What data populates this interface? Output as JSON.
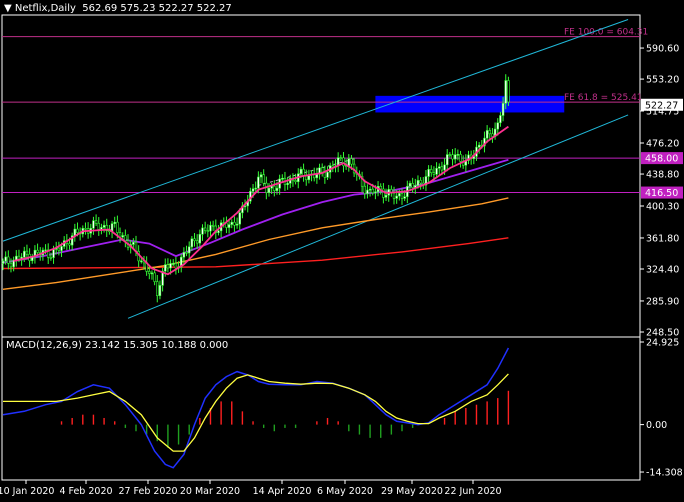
{
  "header": {
    "symbol": "Netflix,Daily",
    "ohlc": "562.69 575.23 522.27 522.27"
  },
  "macd_header": {
    "label": "MACD(12,26,9) 23.142 15.305 10.188 0.000"
  },
  "colors": {
    "background": "#000000",
    "frame": "#ffffff",
    "bull_candle": "#33ff33",
    "bear_candle": "#33ff33",
    "ma_fast": "#ff2f8f",
    "ma_mid": "#a020f0",
    "ma_slow": "#ff9a28",
    "ma_200": "#ff2020",
    "channel": "#20b8d8",
    "fib_line": "#c0308a",
    "level_line": "#c020c0",
    "zone": "#0000ff",
    "macd_line": "#2030ff",
    "signal_line": "#ffff40",
    "hist_pos": "#ff2020",
    "hist_neg": "#20a020",
    "price_tag_bg": "#ffffff",
    "level_tag_bg": "#c020c0"
  },
  "chart_data": [
    {
      "type": "candlestick",
      "symbol": "Netflix",
      "timeframe": "Daily",
      "ylim": [
        248.5,
        628
      ],
      "y_ticks": [
        "590.60",
        "553.20",
        "514.75",
        "476.20",
        "438.80",
        "400.30",
        "361.80",
        "324.40",
        "285.90",
        "248.50"
      ],
      "x_ticks": [
        "10 Jan 2020",
        "4 Feb 2020",
        "27 Feb 2020",
        "20 Mar 2020",
        "14 Apr 2020",
        "6 May 2020",
        "29 May 2020",
        "22 Jun 2020"
      ],
      "last_price": "522.27",
      "close_anchors": [
        [
          0,
          331
        ],
        [
          10,
          342
        ],
        [
          20,
          345
        ],
        [
          26,
          364
        ],
        [
          33,
          376
        ],
        [
          42,
          374
        ],
        [
          50,
          345
        ],
        [
          55,
          320
        ],
        [
          58,
          298
        ],
        [
          61,
          330
        ],
        [
          64,
          325
        ],
        [
          70,
          350
        ],
        [
          74,
          368
        ],
        [
          80,
          375
        ],
        [
          86,
          377
        ],
        [
          90,
          394
        ],
        [
          96,
          436
        ],
        [
          99,
          420
        ],
        [
          105,
          428
        ],
        [
          112,
          437
        ],
        [
          120,
          439
        ],
        [
          126,
          453
        ],
        [
          130,
          455
        ],
        [
          134,
          430
        ],
        [
          138,
          416
        ],
        [
          142,
          420
        ],
        [
          148,
          410
        ],
        [
          152,
          420
        ],
        [
          156,
          428
        ],
        [
          160,
          437
        ],
        [
          166,
          452
        ],
        [
          170,
          464
        ],
        [
          174,
          450
        ],
        [
          178,
          470
        ],
        [
          183,
          487
        ],
        [
          186,
          498
        ],
        [
          188,
          525
        ],
        [
          189,
          545
        ],
        [
          190,
          522.27
        ]
      ],
      "ma_fast": [
        [
          4,
          334
        ],
        [
          12,
          340
        ],
        [
          20,
          350
        ],
        [
          30,
          370
        ],
        [
          40,
          372
        ],
        [
          48,
          352
        ],
        [
          56,
          325
        ],
        [
          62,
          318
        ],
        [
          68,
          330
        ],
        [
          75,
          352
        ],
        [
          80,
          370
        ],
        [
          88,
          392
        ],
        [
          96,
          420
        ],
        [
          104,
          428
        ],
        [
          112,
          436
        ],
        [
          120,
          440
        ],
        [
          128,
          452
        ],
        [
          132,
          444
        ],
        [
          136,
          430
        ],
        [
          144,
          416
        ],
        [
          152,
          418
        ],
        [
          160,
          428
        ],
        [
          168,
          446
        ],
        [
          176,
          458
        ],
        [
          182,
          478
        ],
        [
          190,
          496
        ]
      ],
      "ma_mid": [
        [
          0,
          332
        ],
        [
          15,
          340
        ],
        [
          30,
          350
        ],
        [
          45,
          360
        ],
        [
          55,
          355
        ],
        [
          65,
          340
        ],
        [
          78,
          356
        ],
        [
          90,
          372
        ],
        [
          105,
          390
        ],
        [
          120,
          405
        ],
        [
          132,
          414
        ],
        [
          145,
          418
        ],
        [
          160,
          428
        ],
        [
          175,
          442
        ],
        [
          190,
          456
        ]
      ],
      "ma_slow": [
        [
          0,
          300
        ],
        [
          20,
          308
        ],
        [
          40,
          318
        ],
        [
          60,
          328
        ],
        [
          80,
          342
        ],
        [
          100,
          360
        ],
        [
          120,
          374
        ],
        [
          140,
          384
        ],
        [
          160,
          393
        ],
        [
          180,
          403
        ],
        [
          190,
          410
        ]
      ],
      "ma_200": [
        [
          0,
          325
        ],
        [
          40,
          326
        ],
        [
          80,
          327
        ],
        [
          120,
          335
        ],
        [
          150,
          345
        ],
        [
          175,
          355
        ],
        [
          190,
          362
        ]
      ],
      "channel_lines": [
        [
          [
            0,
            358
          ],
          [
            235,
            625
          ]
        ],
        [
          [
            47,
            265
          ],
          [
            235,
            510
          ]
        ]
      ],
      "dashed_line": [
        [
          96,
          425
        ],
        [
          133,
          458
        ]
      ],
      "fib_lines": [
        {
          "label": "FE 100.0 = 604.31",
          "value": 604.31
        },
        {
          "label": "FE 61.8 = 525.41",
          "value": 525.41
        }
      ],
      "level_lines": [
        {
          "label": "458.00",
          "value": 458.0
        },
        {
          "label": "416.50",
          "value": 416.5
        }
      ],
      "zone": {
        "from_bar": 140,
        "to_bar": 211,
        "low": 513,
        "high": 533
      }
    },
    {
      "type": "histogram+line",
      "title": "MACD(12,26,9) 23.142 15.305 10.188 0.000",
      "ylim": [
        -14.3,
        24.925
      ],
      "y_ticks": [
        "24.925",
        "0.00",
        "-14.308"
      ],
      "macd_line": [
        [
          0,
          3
        ],
        [
          8,
          4
        ],
        [
          16,
          6
        ],
        [
          22,
          7
        ],
        [
          28,
          10
        ],
        [
          34,
          12
        ],
        [
          40,
          11
        ],
        [
          46,
          6
        ],
        [
          52,
          0
        ],
        [
          57,
          -8
        ],
        [
          61,
          -12
        ],
        [
          64,
          -13
        ],
        [
          68,
          -9
        ],
        [
          72,
          0
        ],
        [
          76,
          8
        ],
        [
          80,
          12
        ],
        [
          84,
          14.5
        ],
        [
          88,
          16
        ],
        [
          92,
          15
        ],
        [
          96,
          13
        ],
        [
          100,
          12.2
        ],
        [
          106,
          12
        ],
        [
          112,
          12
        ],
        [
          118,
          13
        ],
        [
          124,
          12.5
        ],
        [
          130,
          11
        ],
        [
          136,
          9
        ],
        [
          140,
          6
        ],
        [
          144,
          3
        ],
        [
          148,
          1
        ],
        [
          152,
          0.5
        ],
        [
          156,
          0
        ],
        [
          160,
          0.5
        ],
        [
          164,
          3
        ],
        [
          170,
          6
        ],
        [
          176,
          9
        ],
        [
          182,
          12
        ],
        [
          186,
          17
        ],
        [
          190,
          23.1
        ]
      ],
      "signal_line": [
        [
          0,
          7
        ],
        [
          10,
          7
        ],
        [
          20,
          7
        ],
        [
          28,
          8
        ],
        [
          34,
          9
        ],
        [
          40,
          10
        ],
        [
          46,
          7
        ],
        [
          52,
          3
        ],
        [
          58,
          -4
        ],
        [
          64,
          -8
        ],
        [
          68,
          -8
        ],
        [
          72,
          -4
        ],
        [
          76,
          2
        ],
        [
          80,
          7
        ],
        [
          84,
          11
        ],
        [
          88,
          14
        ],
        [
          92,
          15
        ],
        [
          96,
          14
        ],
        [
          100,
          13
        ],
        [
          106,
          12.5
        ],
        [
          112,
          12.2
        ],
        [
          118,
          12.5
        ],
        [
          124,
          12.4
        ],
        [
          130,
          11
        ],
        [
          136,
          9
        ],
        [
          140,
          7
        ],
        [
          144,
          4
        ],
        [
          148,
          2
        ],
        [
          152,
          1
        ],
        [
          156,
          0.3
        ],
        [
          160,
          0.3
        ],
        [
          164,
          2
        ],
        [
          170,
          4
        ],
        [
          176,
          7
        ],
        [
          182,
          9
        ],
        [
          186,
          12
        ],
        [
          190,
          15.3
        ]
      ],
      "histogram": [
        [
          0,
          0
        ],
        [
          8,
          0
        ],
        [
          16,
          0
        ],
        [
          22,
          1
        ],
        [
          26,
          2
        ],
        [
          30,
          3
        ],
        [
          34,
          3
        ],
        [
          38,
          2
        ],
        [
          42,
          1
        ],
        [
          46,
          -1
        ],
        [
          50,
          -2
        ],
        [
          54,
          -3
        ],
        [
          58,
          -5
        ],
        [
          62,
          -7
        ],
        [
          66,
          -6
        ],
        [
          70,
          -3
        ],
        [
          74,
          2
        ],
        [
          78,
          5
        ],
        [
          82,
          7
        ],
        [
          86,
          7
        ],
        [
          90,
          4
        ],
        [
          94,
          1
        ],
        [
          98,
          -1
        ],
        [
          102,
          -2
        ],
        [
          106,
          -1
        ],
        [
          110,
          -1
        ],
        [
          114,
          0
        ],
        [
          118,
          1
        ],
        [
          122,
          2
        ],
        [
          126,
          1
        ],
        [
          130,
          -2
        ],
        [
          134,
          -3
        ],
        [
          138,
          -4
        ],
        [
          142,
          -4
        ],
        [
          146,
          -3
        ],
        [
          150,
          -2
        ],
        [
          154,
          -1
        ],
        [
          158,
          0
        ],
        [
          162,
          0
        ],
        [
          166,
          2
        ],
        [
          170,
          4
        ],
        [
          174,
          5
        ],
        [
          178,
          6
        ],
        [
          182,
          7
        ],
        [
          186,
          8
        ],
        [
          190,
          10.2
        ]
      ]
    }
  ]
}
